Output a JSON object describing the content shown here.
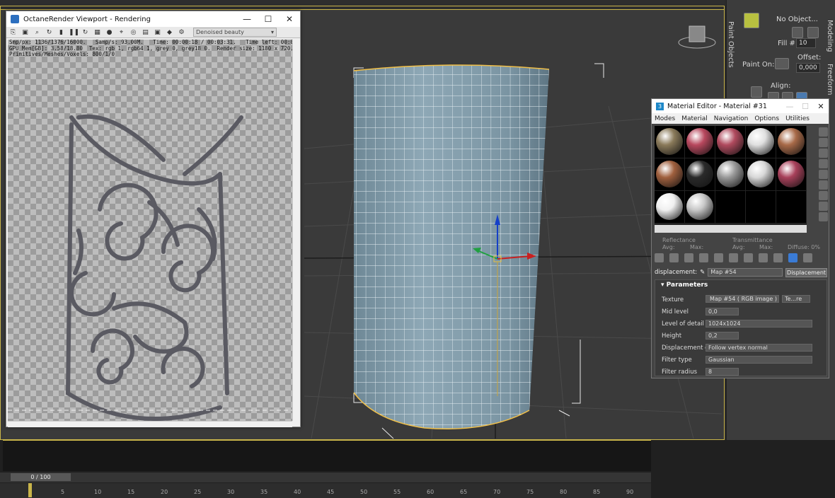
{
  "octane": {
    "title": "OctaneRender Viewport - Rendering",
    "mode": "Denoised beauty",
    "stats": "Smp/px: 1136/1376/16000.   Samp/s: 93.00M.   Time: 00:00:18 / 00:03:31.   Time left: 00:00:18 / 00:03:13.\nGPU Mem[GB]: 3.58/18.80  Tex: rgb 1, rgb64 1, grey 0, grey18 0.  Render size: 1180 x 720.  Zoom: 100%.\nPrimitives/Meshes/Voxels: 800/1/0",
    "minimize": "—",
    "maximize": "☐",
    "close": "✕"
  },
  "cmdpanel": {
    "no_object": "No Object...",
    "fill_label": "Fill #:",
    "fill_value": "10",
    "offset_label": "Offset:",
    "offset_value": "0,000",
    "paint_on_label": "Paint On:",
    "align_label": "Align:",
    "tab_paint_objects": "Paint Objects",
    "tab_modeling": "Modeling",
    "tab_freeform": "Freeform"
  },
  "material_editor": {
    "title": "Material Editor - Material #31",
    "menus": [
      "Modes",
      "Material",
      "Navigation",
      "Options",
      "Utilities"
    ],
    "reflectance_label": "Reflectance",
    "transmittance_label": "Transmittance",
    "avg_label": "Avg:",
    "max_label": "Max:",
    "diffuse_label": "Diffuse: 0%",
    "displacement_label": "displacement:",
    "map_select": "Map #54",
    "displacement_button": "Displacement",
    "parameters_title": "Parameters",
    "params": {
      "texture_label": "Texture",
      "texture_value": "Map #54  ( RGB image )",
      "texture_extra": "Te...re",
      "midlevel_label": "Mid level",
      "midlevel_value": "0,0",
      "lod_label": "Level of detail",
      "lod_value": "1024x1024",
      "height_label": "Height",
      "height_value": "0,2",
      "dispdir_label": "Displacement di...",
      "dispdir_value": "Follow vertex normal",
      "filtertype_label": "Filter type",
      "filtertype_value": "Gaussian",
      "filterradius_label": "Filter radius",
      "filterradius_value": "8"
    },
    "slots": [
      {
        "color": "#8a7a5a"
      },
      {
        "color": "#b8485e"
      },
      {
        "color": "#b04a5e"
      },
      {
        "color": "#e0e0e0"
      },
      {
        "color": "#a86a48"
      },
      {
        "color": "#a0603e"
      },
      {
        "color": "#2a2a2a"
      },
      {
        "color": "#9a9a9a"
      },
      {
        "color": "#d8d8d8"
      },
      {
        "color": "#a8405a"
      },
      {
        "color": "#f0f0f0"
      },
      {
        "color": "#c8c8c8"
      },
      {
        "color": "#000000"
      },
      {
        "color": "#000000"
      },
      {
        "color": "#000000"
      }
    ]
  },
  "timeline": {
    "frame_display": "0 / 100",
    "ticks": [
      "5",
      "10",
      "15",
      "20",
      "25",
      "30",
      "35",
      "40",
      "45",
      "50",
      "55",
      "60",
      "65",
      "70",
      "75",
      "80",
      "85",
      "90"
    ],
    "current_frame": "0"
  },
  "colors": {
    "viewport_bg": "#3a3a3a",
    "selection_yellow": "#c9b54a",
    "cylinder": "#7d97a5"
  }
}
